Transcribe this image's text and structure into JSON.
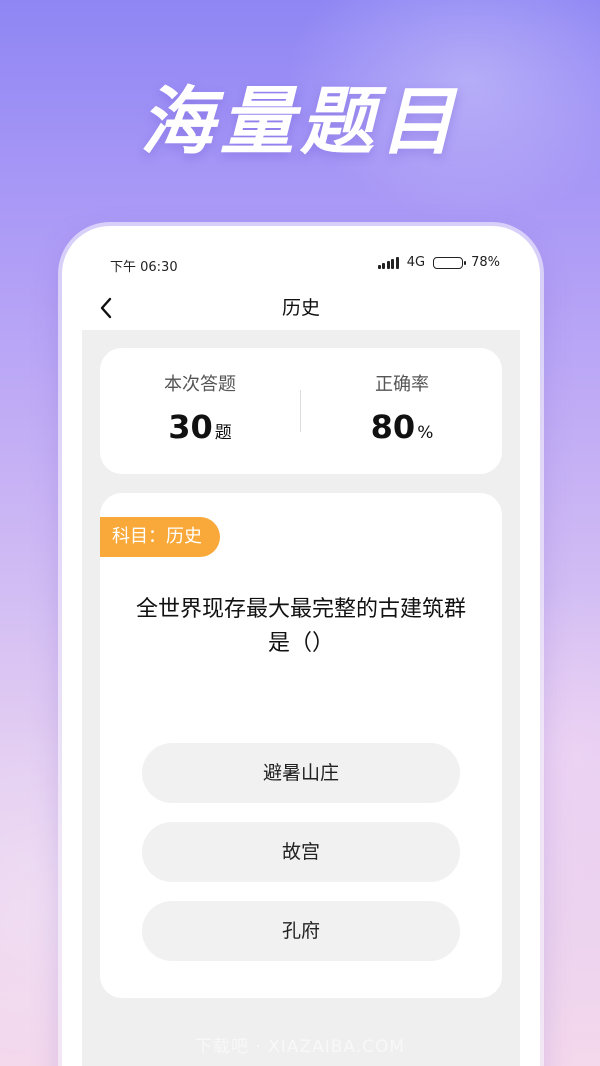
{
  "headline": "海量题目",
  "status_bar": {
    "time": "下午 06:30",
    "network": "4G",
    "battery_percent": "78%",
    "battery_level": 0.78
  },
  "nav": {
    "back_icon": "chevron-left-icon",
    "title": "历史"
  },
  "stats": {
    "answered_label": "本次答题",
    "answered_value": "30",
    "answered_unit": "题",
    "accuracy_label": "正确率",
    "accuracy_value": "80",
    "accuracy_unit": "%"
  },
  "question": {
    "subject_tag": "科目：历史",
    "text": "全世界现存最大最完整的古建筑群是（）",
    "options": [
      "避暑山庄",
      "故宫",
      "孔府"
    ]
  },
  "colors": {
    "tag": "#f8a93a",
    "option_bg": "#f1f1f1",
    "content_bg": "#efefef"
  },
  "watermark": "下载吧 · XIAZAIBA.COM"
}
